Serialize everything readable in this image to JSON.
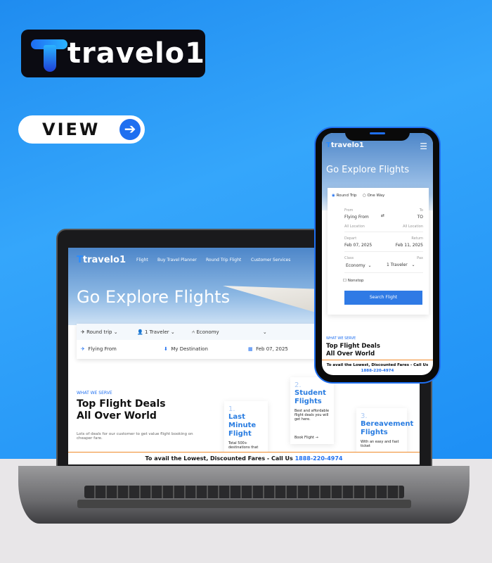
{
  "brand": {
    "name": "travelo1",
    "accent": "#1f6ff0",
    "callbar_border": "#f08a2a"
  },
  "promo": {
    "view_label": "VIEW",
    "arrow_icon": "arrow-right-icon"
  },
  "desktop": {
    "nav": [
      "Flight",
      "Buy Travel Planner",
      "Round Trip Flight",
      "Customer Services"
    ],
    "headline": "Go Explore Flights",
    "search": {
      "trip": "Round trip",
      "travelers": "1 Traveler",
      "class": "Economy",
      "from": "Flying From",
      "to": "My Destination",
      "depart": "Feb 07, 2025"
    },
    "section": {
      "eyebrow": "WHAT WE SERVE",
      "title_1": "Top Flight Deals",
      "title_2": "All Over World",
      "desc": "Lots of deals for our customer to get value flight booking on cheaper fare."
    },
    "cards": [
      {
        "num": "1.",
        "title": "Last Minute Flight",
        "desc": "Total 500+ destinations that"
      },
      {
        "num": "2.",
        "title": "Student Flights",
        "desc": "Best and affordable flight deals you will get here.",
        "link": "Book Flight"
      },
      {
        "num": "3.",
        "title": "Bereavement Flights",
        "desc": "With an easy and fast ticket"
      }
    ],
    "callbar": {
      "text": "To avail the Lowest, Discounted Fares - Call Us",
      "phone": "1888-220-4974"
    }
  },
  "mobile": {
    "headline": "Go Explore Flights",
    "trip_options": [
      "Round Trip",
      "One Way"
    ],
    "selected_trip": "Round Trip",
    "from_label": "From",
    "from_value": "Flying From",
    "from_sub": "All Location",
    "to_label": "To",
    "to_value": "TO",
    "to_sub": "All Location",
    "depart_label": "Depart",
    "depart_value": "Feb 07, 2025",
    "return_label": "Return",
    "return_value": "Feb 11, 2025",
    "class_label": "Class",
    "class_value": "Economy",
    "pax_label": "Pax",
    "pax_value": "1 Traveler",
    "nonstop": "Nonstop",
    "search_button": "Search Flight",
    "eyebrow": "WHAT WE SERVE",
    "title_1": "Top Flight Deals",
    "title_2": "All Over World",
    "callbar": {
      "text": "To avail the Lowest, Discounted Fares - Call Us",
      "phone": "1888-220-4974"
    }
  }
}
